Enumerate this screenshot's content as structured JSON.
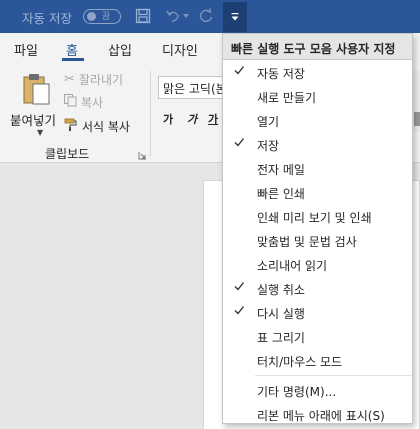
{
  "titlebar": {
    "autosave_label": "자동 저장",
    "toggle_state": "끔"
  },
  "ribbon_tabs": [
    "파일",
    "홈",
    "삽입",
    "디자인"
  ],
  "clipboard": {
    "paste": "붙여넣기",
    "cut": "잘라내기",
    "copy": "복사",
    "format_painter": "서식 복사",
    "group_label": "클립보드"
  },
  "font": {
    "name": "맑은 고딕(본",
    "bold": "가",
    "italic": "가",
    "underline": "가"
  },
  "qat_menu": {
    "title": "빠른 실행 도구 모음 사용자 지정",
    "items": [
      {
        "label": "자동 저장",
        "checked": true
      },
      {
        "label": "새로 만들기",
        "checked": false
      },
      {
        "label": "열기",
        "checked": false
      },
      {
        "label": "저장",
        "checked": true
      },
      {
        "label": "전자 메일",
        "checked": false
      },
      {
        "label": "빠른 인쇄",
        "checked": false
      },
      {
        "label": "인쇄 미리 보기 및 인쇄",
        "checked": false
      },
      {
        "label": "맞춤법 및 문법 검사",
        "checked": false
      },
      {
        "label": "소리내어 읽기",
        "checked": false
      },
      {
        "label": "실행 취소",
        "checked": true
      },
      {
        "label": "다시 실행",
        "checked": true
      },
      {
        "label": "표 그리기",
        "checked": false
      },
      {
        "label": "터치/마우스 모드",
        "checked": false
      }
    ],
    "more_commands": "기타 명령(M)...",
    "show_below": "리본 메뉴 아래에 표시(S)"
  },
  "colors": {
    "titlebar": "#2b579a",
    "accent": "#2b579a",
    "ribbon_bg": "#f3f3f3"
  }
}
